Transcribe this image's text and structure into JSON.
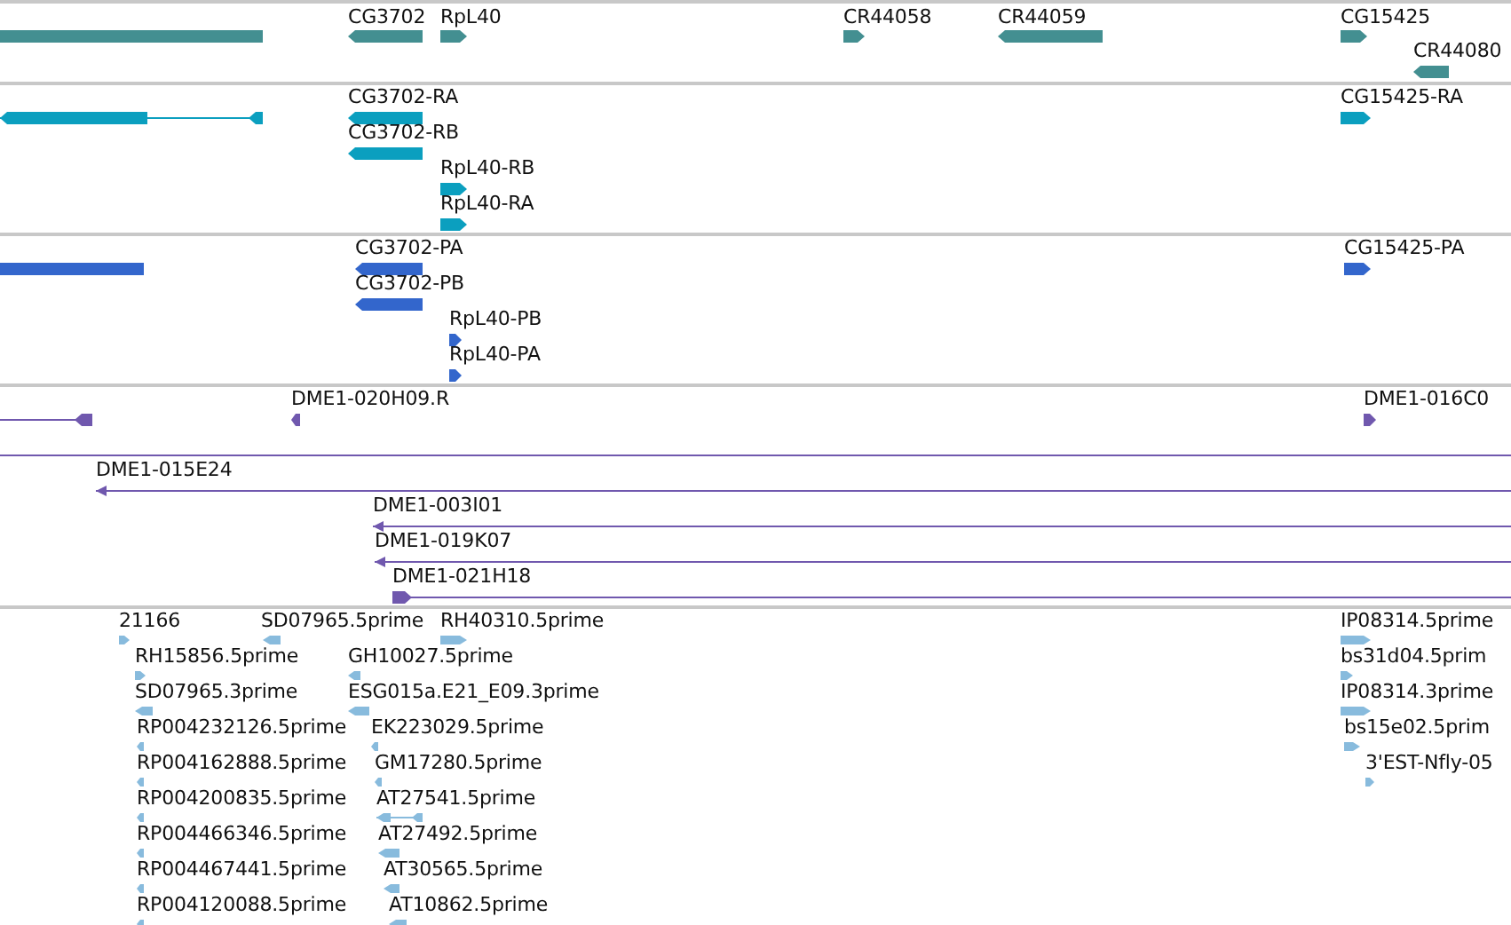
{
  "tracks": [
    {
      "color": "#438f91",
      "features": [
        {
          "kind": "bar",
          "points_left": false,
          "points_right": false
        },
        {
          "kind": "bar",
          "label": "CG3702",
          "points_left": true,
          "points_right": false
        },
        {
          "kind": "bar",
          "label": "RpL40",
          "points_left": false,
          "points_right": true
        },
        {
          "kind": "bar",
          "label": "CR44058",
          "points_left": false,
          "points_right": true
        },
        {
          "kind": "bar",
          "label": "CR44059",
          "points_left": true,
          "points_right": false
        },
        {
          "kind": "bar",
          "label": "CG15425",
          "points_left": false,
          "points_right": true
        },
        {
          "kind": "bar",
          "label": "CR44080",
          "points_left": true,
          "points_right": false
        }
      ]
    },
    {
      "color": "#0b9fbf",
      "features": [
        {
          "kind": "spliced",
          "points_left": true,
          "points_right": false
        },
        {
          "kind": "bar",
          "label": "CG3702-RA",
          "points_left": true,
          "points_right": false
        },
        {
          "kind": "bar",
          "label": "CG3702-RB",
          "points_left": true,
          "points_right": false
        },
        {
          "kind": "bar",
          "label": "RpL40-RB",
          "points_left": false,
          "points_right": true
        },
        {
          "kind": "bar",
          "label": "RpL40-RA",
          "points_left": false,
          "points_right": true
        },
        {
          "kind": "bar",
          "label": "CG15425-RA",
          "points_left": false,
          "points_right": true
        }
      ]
    },
    {
      "color": "#3366cc",
      "features": [
        {
          "kind": "bar",
          "points_left": false,
          "points_right": false
        },
        {
          "kind": "bar",
          "label": "CG3702-PA",
          "points_left": true,
          "points_right": false
        },
        {
          "kind": "bar",
          "label": "CG3702-PB",
          "points_left": true,
          "points_right": false
        },
        {
          "kind": "bar",
          "label": "RpL40-PB",
          "points_left": false,
          "points_right": true
        },
        {
          "kind": "bar",
          "label": "RpL40-PA",
          "points_left": false,
          "points_right": true
        },
        {
          "kind": "bar",
          "label": "CG15425-PA",
          "points_left": false,
          "points_right": true
        }
      ]
    },
    {
      "color": "#7058ae",
      "features": [
        {
          "kind": "spliced",
          "points_left": true,
          "points_right": false
        },
        {
          "kind": "bar",
          "label": "DME1-020H09.R",
          "points_left": true,
          "points_right": false
        },
        {
          "kind": "bar",
          "label": "DME1-016C0",
          "points_left": false,
          "points_right": true
        },
        {
          "kind": "line",
          "points_left": false,
          "points_right": false
        },
        {
          "kind": "line",
          "label": "DME1-015E24",
          "points_left": true,
          "points_right": false
        },
        {
          "kind": "line",
          "label": "DME1-003I01",
          "points_left": true,
          "points_right": false
        },
        {
          "kind": "line",
          "label": "DME1-019K07",
          "points_left": true,
          "points_right": false
        },
        {
          "kind": "spliced",
          "label": "DME1-021H18",
          "points_left": false,
          "points_right": true
        }
      ]
    },
    {
      "color": "#88bbdd",
      "features": [
        {
          "kind": "bar",
          "label": "21166",
          "points_left": false,
          "points_right": true
        },
        {
          "kind": "bar",
          "label": "SD07965.5prime",
          "points_left": true,
          "points_right": false
        },
        {
          "kind": "bar",
          "label": "RH40310.5prime",
          "points_left": false,
          "points_right": true
        },
        {
          "kind": "bar",
          "label": "IP08314.5prime",
          "points_left": false,
          "points_right": true
        },
        {
          "kind": "bar",
          "label": "RH15856.5prime",
          "points_left": false,
          "points_right": true
        },
        {
          "kind": "bar",
          "label": "GH10027.5prime",
          "points_left": true,
          "points_right": false
        },
        {
          "kind": "bar",
          "label": "bs31d04.5prim",
          "points_left": false,
          "points_right": true
        },
        {
          "kind": "bar",
          "label": "SD07965.3prime",
          "points_left": true,
          "points_right": false
        },
        {
          "kind": "bar",
          "label": "ESG015a.E21_E09.3prime",
          "points_left": true,
          "points_right": false
        },
        {
          "kind": "bar",
          "label": "IP08314.3prime",
          "points_left": false,
          "points_right": true
        },
        {
          "kind": "bar",
          "label": "RP004232126.5prime",
          "points_left": true,
          "points_right": false
        },
        {
          "kind": "bar",
          "label": "EK223029.5prime",
          "points_left": true,
          "points_right": false
        },
        {
          "kind": "bar",
          "label": "bs15e02.5prim",
          "points_left": false,
          "points_right": true
        },
        {
          "kind": "bar",
          "label": "RP004162888.5prime",
          "points_left": true,
          "points_right": false
        },
        {
          "kind": "bar",
          "label": "GM17280.5prime",
          "points_left": true,
          "points_right": false
        },
        {
          "kind": "bar",
          "label": "3'EST-Nfly-05",
          "points_left": false,
          "points_right": true
        },
        {
          "kind": "bar",
          "label": "RP004200835.5prime",
          "points_left": true,
          "points_right": false
        },
        {
          "kind": "spliced",
          "label": "AT27541.5prime",
          "points_left": true,
          "points_right": false
        },
        {
          "kind": "bar",
          "label": "RP004466346.5prime",
          "points_left": true,
          "points_right": false
        },
        {
          "kind": "bar",
          "label": "AT27492.5prime",
          "points_left": true,
          "points_right": false
        },
        {
          "kind": "bar",
          "label": "RP004467441.5prime",
          "points_left": true,
          "points_right": false
        },
        {
          "kind": "bar",
          "label": "AT30565.5prime",
          "points_left": true,
          "points_right": false
        },
        {
          "kind": "bar",
          "label": "RP004120088.5prime",
          "points_left": true,
          "points_right": false
        },
        {
          "kind": "bar",
          "label": "AT10862.5prime",
          "points_left": true,
          "points_right": false
        }
      ]
    }
  ]
}
